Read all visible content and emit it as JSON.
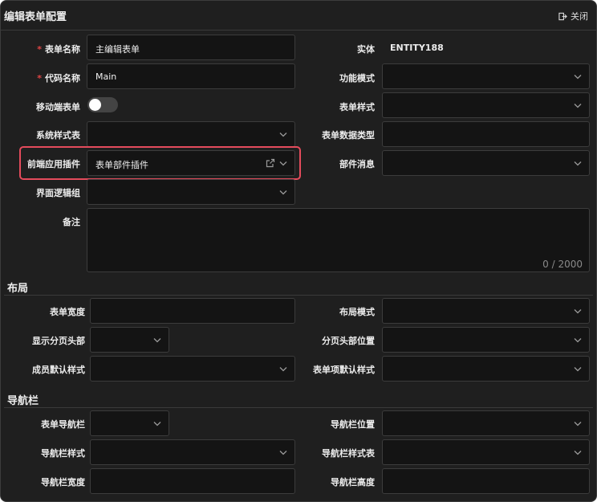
{
  "window": {
    "title": "编辑表单配置",
    "close_label": "关闭"
  },
  "basic": {
    "form_name": {
      "label": "表单名称",
      "value": "主编辑表单",
      "required_mark": "*"
    },
    "code_name": {
      "label": "代码名称",
      "value": "Main",
      "required_mark": "*"
    },
    "mobile_form": {
      "label": "移动端表单",
      "on": false
    },
    "system_style": {
      "label": "系统样式表",
      "value": ""
    },
    "frontend_plugin": {
      "label": "前端应用插件",
      "value": "表单部件插件"
    },
    "logic_group": {
      "label": "界面逻辑组",
      "value": ""
    },
    "remark": {
      "label": "备注",
      "value": "",
      "counter": "0 / 2000"
    },
    "entity": {
      "label": "实体",
      "value": "ENTITY188"
    },
    "func_mode": {
      "label": "功能模式",
      "value": ""
    },
    "form_style": {
      "label": "表单样式",
      "value": ""
    },
    "form_data_type": {
      "label": "表单数据类型",
      "value": ""
    },
    "part_message": {
      "label": "部件消息",
      "value": ""
    }
  },
  "layout": {
    "section_title": "布局",
    "form_width": {
      "label": "表单宽度",
      "value": ""
    },
    "show_page_header": {
      "label": "显示分页头部",
      "value": ""
    },
    "member_default_style": {
      "label": "成员默认样式",
      "value": ""
    },
    "layout_mode": {
      "label": "布局模式",
      "value": ""
    },
    "page_header_pos": {
      "label": "分页头部位置",
      "value": ""
    },
    "item_default_style": {
      "label": "表单项默认样式",
      "value": ""
    }
  },
  "nav": {
    "section_title": "导航栏",
    "form_nav": {
      "label": "表单导航栏",
      "value": ""
    },
    "nav_style": {
      "label": "导航栏样式",
      "value": ""
    },
    "nav_width": {
      "label": "导航栏宽度",
      "value": ""
    },
    "nav_pos": {
      "label": "导航栏位置",
      "value": ""
    },
    "nav_stylesheet": {
      "label": "导航栏样式表",
      "value": ""
    },
    "nav_height": {
      "label": "导航栏高度",
      "value": ""
    }
  },
  "colors": {
    "required": "#e04545",
    "highlight": "#e44b5c",
    "panel_bg": "#1f1f1f",
    "input_bg": "#141414"
  },
  "icons": {
    "close": "sign-out-icon",
    "chevron": "chevron-down-icon",
    "external": "external-link-icon"
  }
}
